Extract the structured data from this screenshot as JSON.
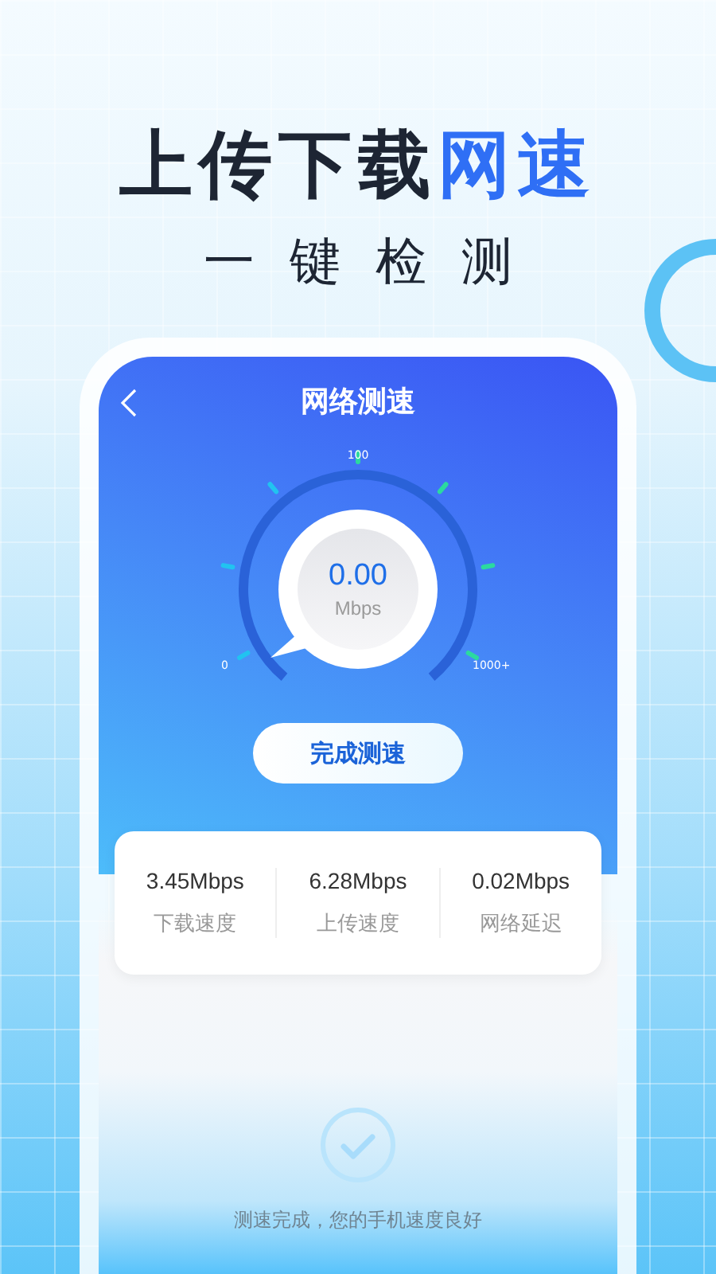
{
  "headline": {
    "plain": "上传下载",
    "accent": "网速"
  },
  "subtitle": "一键检测",
  "screen": {
    "title": "网络测速",
    "gauge": {
      "value": "0.00",
      "unit": "Mbps",
      "labels": {
        "min": "0",
        "mid": "100",
        "max": "1000+"
      }
    },
    "button": "完成测速",
    "stats": [
      {
        "value": "3.45Mbps",
        "label": "下载速度"
      },
      {
        "value": "6.28Mbps",
        "label": "上传速度"
      },
      {
        "value": "0.02Mbps",
        "label": "网络延迟"
      }
    ],
    "message": "测速完成，您的手机速度良好"
  }
}
